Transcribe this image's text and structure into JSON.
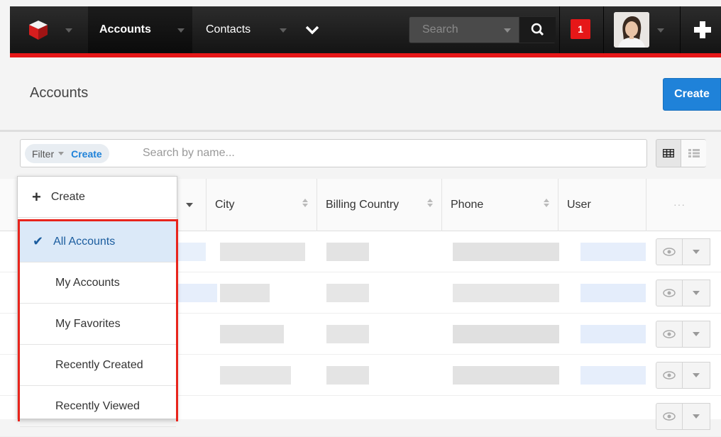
{
  "nav": {
    "accounts_label": "Accounts",
    "contacts_label": "Contacts",
    "search_placeholder": "Search",
    "notification_count": "1"
  },
  "header": {
    "title": "Accounts",
    "create_label": "Create"
  },
  "filter": {
    "filter_label": "Filter",
    "create_label": "Create",
    "search_placeholder": "Search by name..."
  },
  "table": {
    "columns": [
      "City",
      "Billing Country",
      "Phone",
      "User"
    ]
  },
  "menu": {
    "create_label": "Create",
    "items": [
      "All Accounts",
      "My Accounts",
      "My Favorites",
      "Recently Created",
      "Recently Viewed"
    ],
    "selected": "All Accounts"
  },
  "colors": {
    "accent_blue": "#1f82d9",
    "brand_red": "#e61718",
    "highlight_border": "#e8241c"
  }
}
